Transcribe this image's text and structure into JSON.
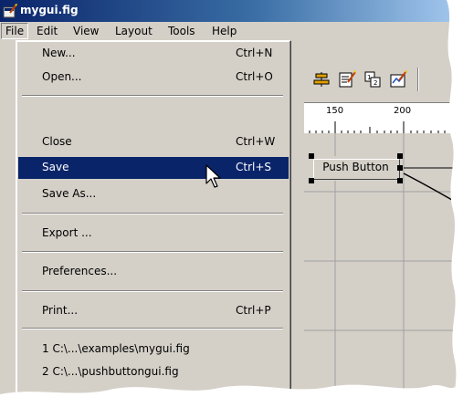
{
  "window": {
    "title": "mygui.fig"
  },
  "menubar": {
    "items": [
      {
        "label": "File"
      },
      {
        "label": "Edit"
      },
      {
        "label": "View"
      },
      {
        "label": "Layout"
      },
      {
        "label": "Tools"
      },
      {
        "label": "Help"
      }
    ],
    "open_menu": "File"
  },
  "file_menu": {
    "items": [
      {
        "label": "New...",
        "accelerator": "Ctrl+N"
      },
      {
        "label": "Open...",
        "accelerator": "Ctrl+O"
      },
      {
        "label": "Close",
        "accelerator": "Ctrl+W"
      },
      {
        "label": "Save",
        "accelerator": "Ctrl+S",
        "selected": true
      },
      {
        "label": "Save As...",
        "accelerator": ""
      },
      {
        "label": "Export ...",
        "accelerator": ""
      },
      {
        "label": "Preferences...",
        "accelerator": ""
      },
      {
        "label": "Print...",
        "accelerator": "Ctrl+P"
      },
      {
        "label": "1 C:\\...\\examples\\mygui.fig",
        "accelerator": ""
      },
      {
        "label": "2 C:\\...\\pushbuttongui.fig",
        "accelerator": ""
      }
    ]
  },
  "toolbar": {
    "icons": [
      "align-objects-icon",
      "menu-editor-icon",
      "tab-order-editor-icon",
      "m-file-editor-icon"
    ]
  },
  "ruler": {
    "labels": [
      "150",
      "200"
    ]
  },
  "canvas": {
    "push_button": {
      "label": "Push Button",
      "selected": true
    }
  },
  "colors": {
    "title_bar_start": "#0a246a",
    "title_bar_end": "#a6caf0",
    "menu_highlight": "#0a246a",
    "face": "#d4d0c8"
  }
}
